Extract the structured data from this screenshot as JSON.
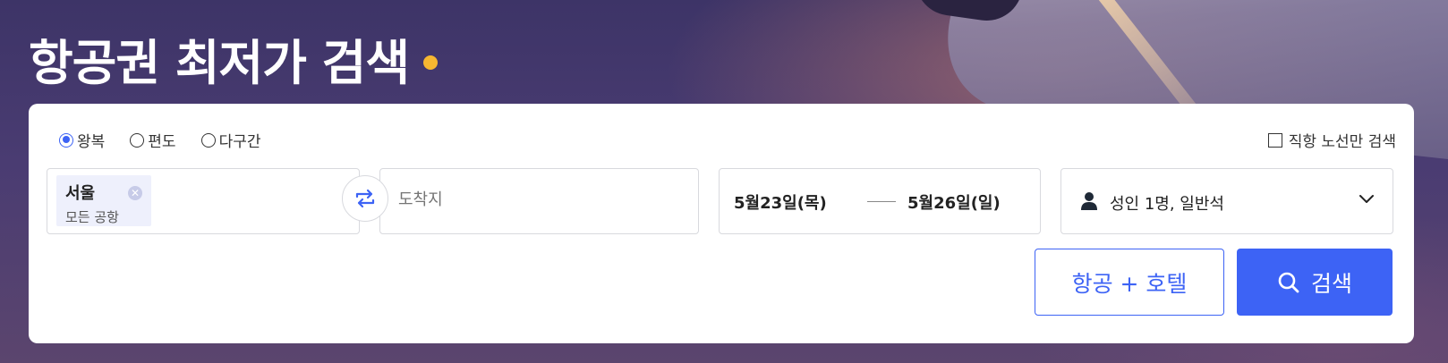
{
  "page": {
    "title": "항공권 최저가 검색",
    "accent_color": "#3d63f5",
    "dot_color": "#f7b731"
  },
  "trip_types": {
    "round_trip": "왕복",
    "one_way": "편도",
    "multi_city": "다구간",
    "selected": "왕복"
  },
  "direct_only": {
    "label": "직항 노선만 검색",
    "checked": false
  },
  "origin": {
    "city": "서울",
    "airport": "모든 공항",
    "clear_icon": "close-icon"
  },
  "swap_icon": "swap-icon",
  "destination": {
    "placeholder": "도착지"
  },
  "dates": {
    "departure": "5월23일(목)",
    "return": "5월26일(일)"
  },
  "passengers": {
    "label": "성인 1명, 일반석",
    "icon": "person-icon",
    "chevron": "chevron-down-icon"
  },
  "buttons": {
    "combo": "항공 + 호텔",
    "search": "검색"
  }
}
